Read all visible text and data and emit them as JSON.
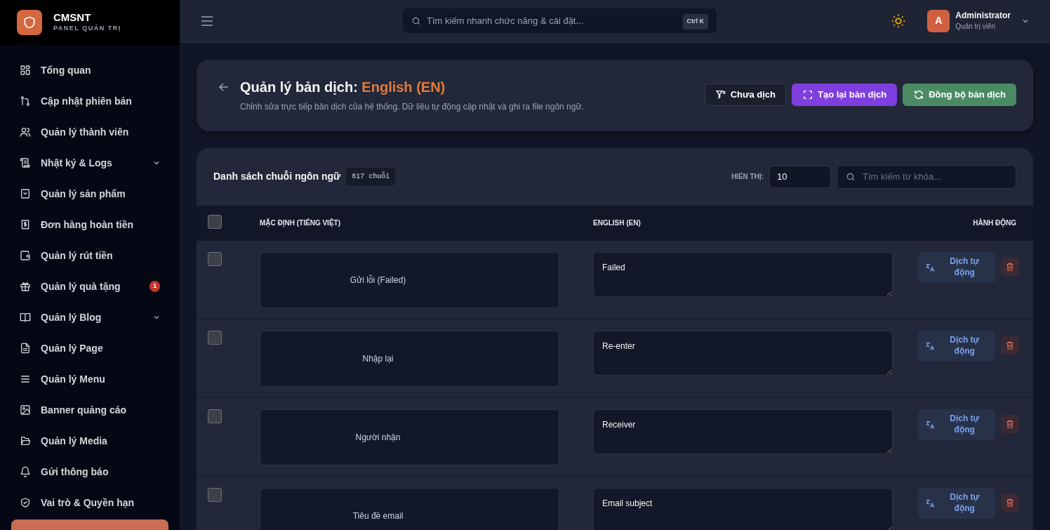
{
  "brand": {
    "name": "CMSNT",
    "subtitle": "PANEL QUẢN TRỊ"
  },
  "sidebar": {
    "items": [
      {
        "label": "Tổng quan",
        "expandable": false
      },
      {
        "label": "Cập nhật phiên bản",
        "expandable": false
      },
      {
        "label": "Quản lý thành viên",
        "expandable": false
      },
      {
        "label": "Nhật ký & Logs",
        "expandable": true
      },
      {
        "label": "Quản lý sản phẩm",
        "expandable": false
      },
      {
        "label": "Đơn hàng hoàn tiền",
        "expandable": false
      },
      {
        "label": "Quản lý rút tiền",
        "expandable": false
      },
      {
        "label": "Quản lý quà tặng",
        "expandable": false,
        "badge": "1"
      },
      {
        "label": "Quản lý Blog",
        "expandable": true
      },
      {
        "label": "Quản lý Page",
        "expandable": false
      },
      {
        "label": "Quản lý Menu",
        "expandable": false
      },
      {
        "label": "Banner quảng cáo",
        "expandable": false
      },
      {
        "label": "Quản lý Media",
        "expandable": false
      },
      {
        "label": "Gửi thông báo",
        "expandable": false
      },
      {
        "label": "Vai trò & Quyền hạn",
        "expandable": false
      }
    ]
  },
  "topbar": {
    "search": {
      "placeholder": "Tìm kiếm nhanh chức năng & cài đặt...",
      "shortcut": "Ctrl K"
    },
    "user": {
      "initial": "A",
      "name": "Administrator",
      "role": "Quản trị viên"
    }
  },
  "header": {
    "title": "Quản lý bản dịch:",
    "title_highlight": "English (EN)",
    "subtitle": "Chỉnh sửa trực tiếp bản dịch của hệ thống. Dữ liệu tự động cập nhật và ghi ra file ngôn ngữ.",
    "buttons": [
      {
        "label": "Chưa dịch",
        "kind": "outline"
      },
      {
        "label": "Tạo lại bản dịch",
        "kind": "purple"
      },
      {
        "label": "Đồng bộ bản dịch",
        "kind": "green"
      }
    ]
  },
  "table": {
    "title": "Danh sách chuỗi ngôn ngữ",
    "count": "617 chuỗi",
    "show_label": "HIỂN THỊ:",
    "page_size": "10",
    "search": {
      "placeholder": "Tìm kiếm từ khóa..."
    },
    "select_all": {
      "checked": false
    },
    "columns": [
      "MẶC ĐỊNH (TIẾNG VIỆT)",
      "ENGLISH (EN)",
      "HÀNH ĐỘNG"
    ],
    "rows": [
      {
        "checked": false,
        "source": "Gửi lỗi (Failed)",
        "translation": "Failed",
        "action": "Dịch tự động"
      },
      {
        "checked": false,
        "source": "Nhập lại",
        "translation": "Re-enter",
        "action": "Dịch tự động"
      },
      {
        "checked": false,
        "source": "Người nhận",
        "translation": "Receiver",
        "action": "Dịch tự động"
      },
      {
        "checked": false,
        "source": "Tiêu đề email",
        "translation": "Email subject",
        "action": "Dịch tự động"
      }
    ]
  }
}
